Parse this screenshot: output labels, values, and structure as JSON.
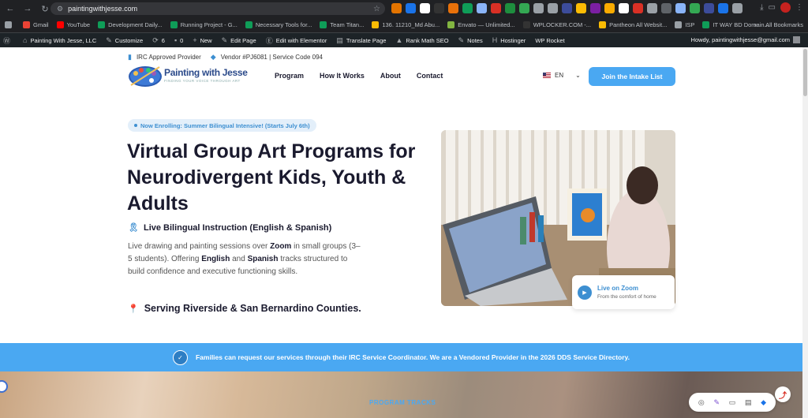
{
  "browser": {
    "url": "paintingwithjesse.com",
    "extension_colors": [
      "#e37400",
      "#1a73e8",
      "#ffffff",
      "#333333",
      "#e8710a",
      "#0f9d58",
      "#8ab4f8",
      "#d93025",
      "#1e8e3e",
      "#34a853",
      "#9aa0a6",
      "#9aa0a6",
      "#3c4c9a",
      "#fbbc04",
      "#7b1fa2",
      "#f9ab00",
      "#ffffff",
      "#d93025",
      "#9aa0a6",
      "#5f6368",
      "#8ab4f8",
      "#34a853",
      "#3c4c9a",
      "#1a73e8",
      "#9aa0a6"
    ]
  },
  "bookmarks": {
    "items": [
      {
        "label": "Gmail",
        "color": "#ea4335"
      },
      {
        "label": "YouTube",
        "color": "#ff0000"
      },
      {
        "label": "Development Daily...",
        "color": "#0f9d58"
      },
      {
        "label": "Running Project - G...",
        "color": "#0f9d58"
      },
      {
        "label": "Necessary Tools for...",
        "color": "#0f9d58"
      },
      {
        "label": "Team Titan...",
        "color": "#0f9d58"
      },
      {
        "label": "136. 11210_Md Abu...",
        "color": "#fbbc04"
      },
      {
        "label": "Envato — Unlimited...",
        "color": "#82b541"
      },
      {
        "label": "WPLOCKER.COM -...",
        "color": "#333333"
      },
      {
        "label": "Pantheon All Websit...",
        "color": "#fbbc04"
      },
      {
        "label": "ISP",
        "color": "#9aa0a6"
      },
      {
        "label": "IT WAY BD Domain...",
        "color": "#0f9d58"
      }
    ],
    "more": "»",
    "all_bookmarks": "All Bookmarks"
  },
  "wpbar": {
    "site": "Painting With Jesse, LLC",
    "customize": "Customize",
    "updates": "6",
    "comments": "0",
    "new": "New",
    "edit_page": "Edit Page",
    "elementor": "Edit with Elementor",
    "translate": "Translate Page",
    "rankmath": "Rank Math SEO",
    "notes": "Notes",
    "hostinger": "Hostinger",
    "wprocket": "WP Rocket",
    "howdy": "Howdy, paintingwithjesse@gmail.com"
  },
  "topinfo": {
    "irc": "IRC Approved Provider",
    "vendor": "Vendor #PJ6081 | Service Code 094"
  },
  "logo": {
    "title": "Painting with Jesse",
    "tagline": "FINDING YOUR VOICE THROUGH ART"
  },
  "nav": {
    "items": [
      "Program",
      "How It Works",
      "About",
      "Contact"
    ],
    "lang": "EN",
    "cta": "Join the Intake List"
  },
  "hero": {
    "pill": "Now Enrolling: Summer Bilingual Intensive! (Starts July 6th)",
    "title": "Virtual Group Art Programs for Neurodivergent Kids, Youth & Adults",
    "subtitle": "Live Bilingual Instruction (English & Spanish)",
    "desc_1": "Live drawing and painting sessions over ",
    "desc_zoom": "Zoom",
    "desc_2": " in small groups (3–5 students). Offering ",
    "desc_english": "English",
    "desc_3": " and ",
    "desc_spanish": "Spanish",
    "desc_4": " tracks structured to build confidence and executive functioning skills.",
    "serving": "Serving Riverside & San Bernardino Counties."
  },
  "zoom_card": {
    "title": "Live on Zoom",
    "subtitle": "From the comfort of home"
  },
  "banner": {
    "text": "Families can request our services through their IRC Service Coordinator. We are a Vendored Provider in the 2026 DDS Service Directory."
  },
  "section": {
    "program_tracks": "PROGRAM TRACKS"
  }
}
